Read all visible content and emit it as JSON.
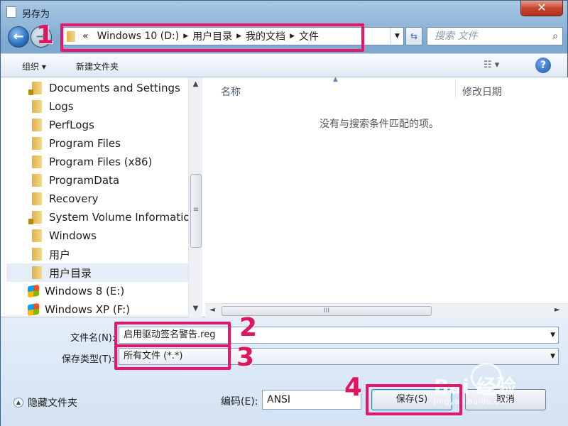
{
  "window": {
    "title": "另存为",
    "close_glyph": "✕"
  },
  "nav": {
    "back_glyph": "←",
    "forward_glyph": "→",
    "address": {
      "overflow": "«",
      "crumbs": [
        "Windows 10 (D:)",
        "用户目录",
        "我的文档",
        "文件"
      ]
    },
    "search_placeholder": "搜索 文件",
    "search_glyph": "⌕"
  },
  "toolbar": {
    "organize_label": "组织 ▾",
    "new_folder_label": "新建文件夹",
    "view_glyph": "☷ ▾",
    "help_glyph": "?"
  },
  "tree": {
    "items": [
      {
        "label": "Documents and Settings",
        "icon": "folder-lock-icon"
      },
      {
        "label": "Logs",
        "icon": "folder-icon"
      },
      {
        "label": "PerfLogs",
        "icon": "folder-icon"
      },
      {
        "label": "Program Files",
        "icon": "folder-icon"
      },
      {
        "label": "Program Files (x86)",
        "icon": "folder-icon"
      },
      {
        "label": "ProgramData",
        "icon": "folder-icon"
      },
      {
        "label": "Recovery",
        "icon": "folder-icon"
      },
      {
        "label": "System Volume Informatio",
        "icon": "folder-lock-icon"
      },
      {
        "label": "Windows",
        "icon": "folder-icon"
      },
      {
        "label": "用户",
        "icon": "folder-icon"
      },
      {
        "label": "用户目录",
        "icon": "folder-icon",
        "selected": true
      },
      {
        "label": "Windows 8 (E:)",
        "icon": "drive-icon"
      },
      {
        "label": "Windows XP (F:)",
        "icon": "drive-icon"
      }
    ],
    "scroll_up": "▲",
    "scroll_down": "▼",
    "thumb_grip": "≡"
  },
  "filelist": {
    "columns": [
      "名称",
      "修改日期"
    ],
    "sort_glyph": "▲",
    "empty_message": "没有与搜索条件匹配的项。",
    "hscroll_left": "◄",
    "hscroll_right": "►",
    "hthumb_grip": "III"
  },
  "form": {
    "filename_label": "文件名(N):",
    "filename_value": "启用驱动签名警告.reg",
    "filetype_label": "保存类型(T):",
    "filetype_value": "所有文件 (*.*)",
    "encoding_label": "编码(E):",
    "encoding_value": "ANSI",
    "hide_folders_label": "隐藏文件夹",
    "save_label": "保存(S)",
    "cancel_label": "取消",
    "dropdown_glyph": "▼"
  },
  "annotations": {
    "step1": "1",
    "step2": "2",
    "step3": "3",
    "step4": "4",
    "color": "#e8156a"
  },
  "watermark": {
    "brand": "Bai 经验",
    "url": "jingyan.baidu.com"
  }
}
